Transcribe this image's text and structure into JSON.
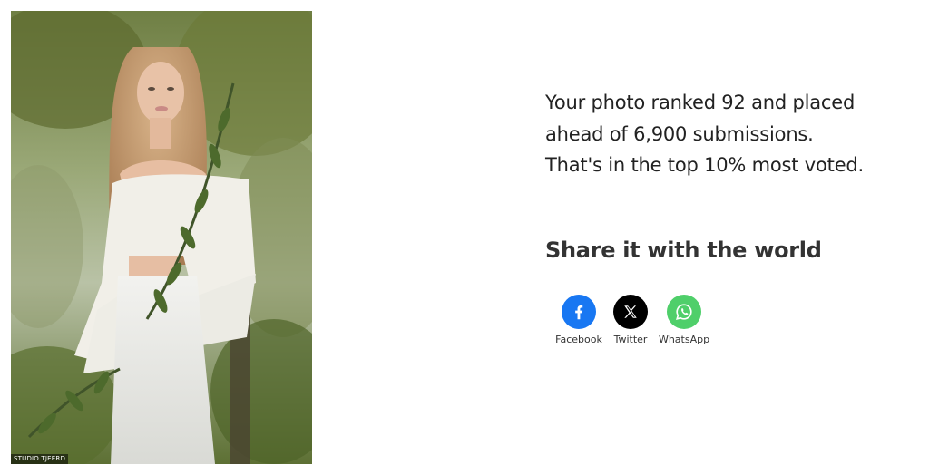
{
  "photo": {
    "credit": "STUDIO TJEERD"
  },
  "result": {
    "lines": [
      "Your photo ranked 92 and placed",
      "ahead of 6,900 submissions.",
      "That's in the top 10% most voted."
    ]
  },
  "share": {
    "title": "Share it with the world",
    "buttons": [
      {
        "label": "Facebook",
        "icon": "facebook-icon",
        "color": "#1877f2"
      },
      {
        "label": "Twitter",
        "icon": "x-twitter-icon",
        "color": "#000000"
      },
      {
        "label": "WhatsApp",
        "icon": "whatsapp-icon",
        "color": "#4fcf6a"
      }
    ]
  }
}
